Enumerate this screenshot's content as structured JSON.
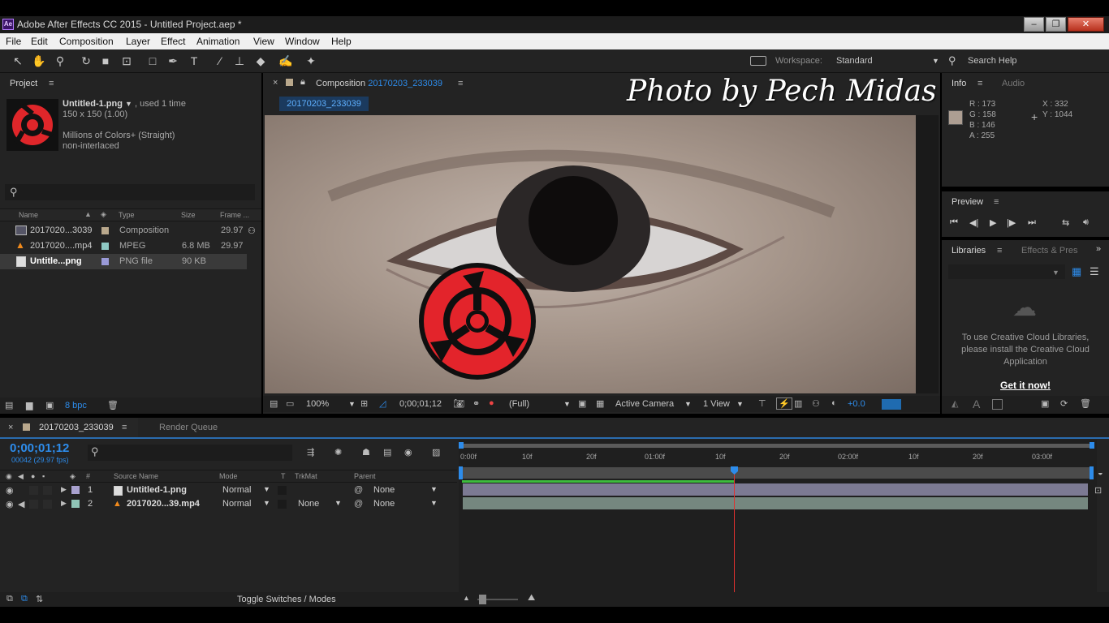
{
  "window": {
    "title": "Adobe After Effects CC 2015 - Untitled Project.aep *",
    "app_icon": "Ae",
    "minimize": "–",
    "maximize": "❐",
    "close": "✕"
  },
  "menu": [
    "File",
    "Edit",
    "Composition",
    "Layer",
    "Effect",
    "Animation",
    "View",
    "Window",
    "Help"
  ],
  "toolbar": {
    "tools": [
      "selection-tool",
      "hand-tool",
      "zoom-tool",
      "rotate-tool",
      "camera-tool",
      "pan-behind-tool",
      "rectangle-tool",
      "pen-tool",
      "type-tool",
      "brush-tool",
      "clone-stamp-tool",
      "eraser-tool",
      "roto-brush-tool",
      "puppet-pin-tool"
    ],
    "workspace_label": "Workspace:",
    "workspace_value": "Standard",
    "search_placeholder": "Search Help"
  },
  "watermark": "Photo by Pech Midas",
  "project": {
    "title": "Project",
    "menu_icon": "≡",
    "selected_name": "Untitled-1.png",
    "selected_usage": ", used 1 time",
    "selected_dims": "150 x 150 (1.00)",
    "selected_colors": "Millions of Colors+ (Straight)",
    "selected_interlace": "non-interlaced",
    "columns": [
      "Name",
      "Type",
      "Size",
      "Frame ..."
    ],
    "items": [
      {
        "name": "2017020...3039",
        "type": "Composition",
        "size": "",
        "frame": "29.97",
        "label_color": "#b9a88c",
        "icon": "composition-icon"
      },
      {
        "name": "2017020....mp4",
        "type": "MPEG",
        "size": "6.8 MB",
        "frame": "29.97",
        "label_color": "#8fc9c4",
        "icon": "vlc-cone-icon"
      },
      {
        "name": "Untitle...png",
        "type": "PNG file",
        "size": "90 KB",
        "frame": "",
        "label_color": "#9a9ad8",
        "icon": "image-file-icon"
      }
    ],
    "bpc": "8 bpc"
  },
  "composition": {
    "panel_title_prefix": "Composition",
    "name": "20170203_233039",
    "tab_label": "20170203_233039",
    "zoom": "100%",
    "timecode": "0;00;01;12",
    "resolution": "(Full)",
    "camera": "Active Camera",
    "views": "1 View",
    "exposure": "+0.0"
  },
  "info": {
    "title": "Info",
    "tab_audio": "Audio",
    "r": "R : 173",
    "g": "G : 158",
    "b": "B : 146",
    "a": "A : 255",
    "x": "X : 332",
    "y": "Y : 1044",
    "swatch_color": "#ad9e92"
  },
  "preview": {
    "title": "Preview"
  },
  "libraries": {
    "title": "Libraries",
    "tab_effects": "Effects & Pres",
    "message": "To use Creative Cloud Libraries, please install the Creative Cloud Application",
    "link": "Get it now!"
  },
  "timeline": {
    "comp_tab": "20170203_233039",
    "render_queue_tab": "Render Queue",
    "timecode": "0;00;01;12",
    "frames": "00042 (29.97 fps)",
    "columns": {
      "source_name": "Source Name",
      "mode": "Mode",
      "t": "T",
      "trkmat": "TrkMat",
      "parent": "Parent"
    },
    "layers": [
      {
        "num": "1",
        "name": "Untitled-1.png",
        "mode": "Normal",
        "trkmat": "",
        "parent": "None",
        "label_color": "#a9a2cf",
        "icon": "image-file-icon"
      },
      {
        "num": "2",
        "name": "2017020...39.mp4",
        "mode": "Normal",
        "trkmat": "None",
        "parent": "None",
        "label_color": "#8fc4b6",
        "icon": "vlc-cone-icon"
      }
    ],
    "ruler": [
      "0:00f",
      "10f",
      "20f",
      "01:00f",
      "10f",
      "20f",
      "02:00f",
      "10f",
      "20f",
      "03:00f"
    ],
    "toggle_label": "Toggle Switches / Modes"
  }
}
